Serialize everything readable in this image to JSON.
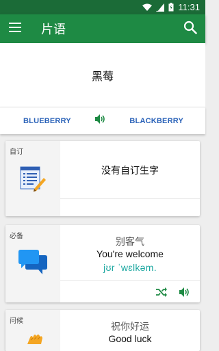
{
  "status_bar": {
    "time": "11:31"
  },
  "app_bar": {
    "title": "片语"
  },
  "word_panel": {
    "word": "黑莓"
  },
  "lang_bar": {
    "left_label": "BLUEBERRY",
    "right_label": "BLACKBERRY"
  },
  "cards": [
    {
      "category": "自订",
      "empty_text": "没有自订生字",
      "icon": "notepad-pencil-icon"
    },
    {
      "category": "必备",
      "chinese": "别客气",
      "english": "You're welcome",
      "phonetic": "jʊr ˈwɛlkəm.",
      "icon": "chat-bubbles-icon"
    },
    {
      "category": "问候",
      "chinese": "祝你好运",
      "english": "Good luck",
      "icon": "waving-hand-icon"
    }
  ],
  "colors": {
    "primary": "#1e8a44",
    "status": "#1b6b37",
    "link": "#2a62b8",
    "accent": "#1ba7a0"
  }
}
